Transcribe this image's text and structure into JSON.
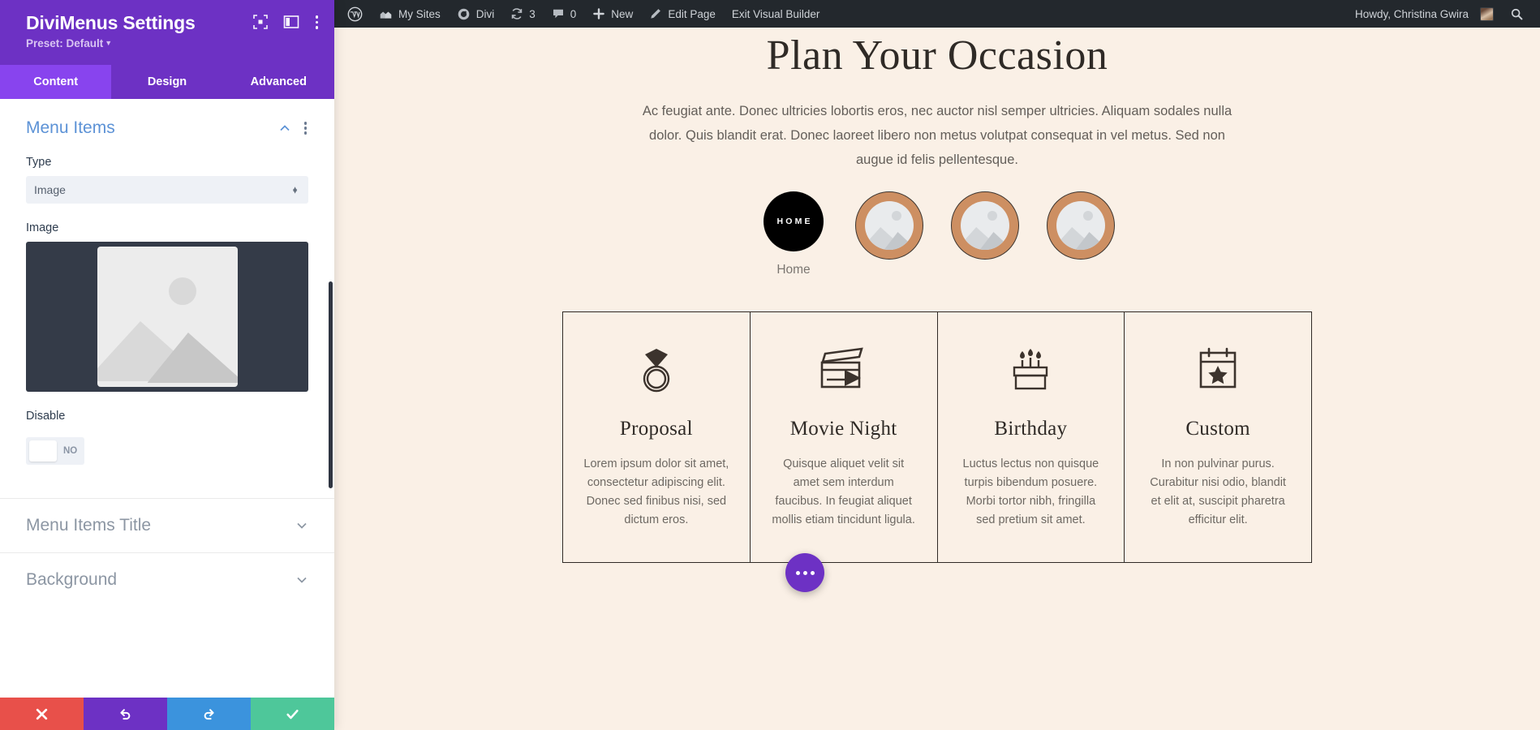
{
  "sidebar": {
    "title": "DiviMenus Settings",
    "preset": "Preset: Default",
    "header_icons": [
      {
        "name": "focus-icon"
      },
      {
        "name": "layout-columns-icon"
      },
      {
        "name": "more-vertical-icon"
      }
    ],
    "tabs": [
      {
        "label": "Content",
        "active": true
      },
      {
        "label": "Design",
        "active": false
      },
      {
        "label": "Advanced",
        "active": false
      }
    ],
    "sections": [
      {
        "title": "Menu Items",
        "open": true,
        "fields": [
          {
            "label": "Type",
            "type": "select",
            "value": "Image"
          },
          {
            "label": "Image",
            "type": "image",
            "value": "image-placeholder"
          },
          {
            "label": "Disable",
            "type": "toggle",
            "value": "NO"
          }
        ]
      },
      {
        "title": "Menu Items Title",
        "open": false
      },
      {
        "title": "Background",
        "open": false
      }
    ],
    "footer_buttons": [
      {
        "name": "discard-button",
        "icon": "close-icon",
        "color": "#e8504a"
      },
      {
        "name": "undo-button",
        "icon": "undo-icon",
        "color": "#6d31c4"
      },
      {
        "name": "redo-button",
        "icon": "redo-icon",
        "color": "#3b93dd"
      },
      {
        "name": "save-button",
        "icon": "check-icon",
        "color": "#4ec79a"
      }
    ]
  },
  "adminbar": {
    "items": [
      {
        "label": "",
        "icon": "wordpress-logo-icon"
      },
      {
        "label": "My Sites",
        "icon": "sites-icon"
      },
      {
        "label": "Divi",
        "icon": "divi-icon"
      },
      {
        "label": "3",
        "icon": "updates-icon"
      },
      {
        "label": "0",
        "icon": "comment-icon"
      },
      {
        "label": "New",
        "icon": "plus-icon"
      },
      {
        "label": "Edit Page",
        "icon": "pencil-icon"
      },
      {
        "label": "Exit Visual Builder",
        "icon": ""
      }
    ],
    "howdy": "Howdy, Christina Gwira",
    "search_icon": "search-icon"
  },
  "page": {
    "heading": "Plan Your Occasion",
    "lead": "Ac feugiat ante. Donec ultricies lobortis eros, nec auctor nisl semper ultricies. Aliquam sodales nulla dolor. Quis blandit erat. Donec laoreet libero non metus volutpat consequat in vel metus. Sed non augue id felis pellentesque.",
    "menu_items": [
      {
        "type": "text",
        "text": "HOME",
        "label": "Home"
      },
      {
        "type": "image",
        "text": "",
        "label": ""
      },
      {
        "type": "image",
        "text": "",
        "label": ""
      },
      {
        "type": "image",
        "text": "",
        "label": ""
      }
    ],
    "cards": [
      {
        "icon": "ring-icon",
        "title": "Proposal",
        "text": "Lorem ipsum dolor sit amet, consectetur adipiscing elit. Donec sed finibus nisi, sed dictum eros."
      },
      {
        "icon": "clapperboard-icon",
        "title": "Movie Night",
        "text": "Quisque aliquet velit sit amet sem interdum faucibus. In feugiat aliquet mollis etiam tincidunt ligula."
      },
      {
        "icon": "birthday-cake-icon",
        "title": "Birthday",
        "text": "Luctus lectus non quisque turpis bibendum posuere. Morbi tortor nibh, fringilla sed pretium sit amet."
      },
      {
        "icon": "calendar-star-icon",
        "title": "Custom",
        "text": "In non pulvinar purus. Curabitur nisi odio, blandit et elit at, suscipit pharetra efficitur elit."
      }
    ],
    "fab": "more-options-icon"
  },
  "colors": {
    "brand_purple": "#6d31c4",
    "tab_active": "#8844ee",
    "section_title": "#5c92d6",
    "page_bg": "#faf0e6",
    "circle_accent": "#cd8f62",
    "ink": "#2f2a26"
  }
}
